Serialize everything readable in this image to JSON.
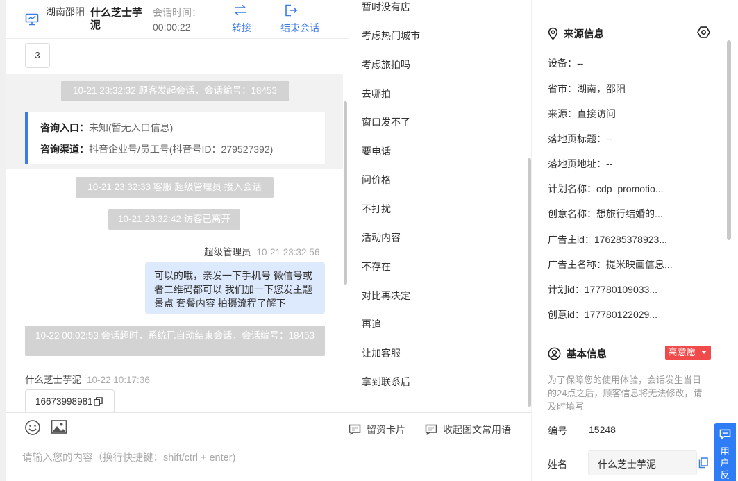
{
  "header": {
    "location": "湖南邵阳",
    "visitor_name": "什么芝士芋泥",
    "session_time_label": "会话时间：",
    "session_time_value": "00:00:22",
    "transfer_label": "转接",
    "end_label": "结束会话"
  },
  "messages": {
    "chip_count": "3",
    "system_1": "10-21 23:32:32 顾客发起会话，会话编号：18453",
    "entry_label": "咨询入口：",
    "entry_value": "未知(暂无入口信息)",
    "channel_label": "咨询渠道：",
    "channel_value": "抖音企业号/员工号(抖音号ID：279527392)",
    "system_2": "10-21 23:32:33 客服 超级管理员 接入会话",
    "system_3": "10-21 23:32:42 访客已离开",
    "agent_name": "超级管理员",
    "agent_time": "10-21 23:32:56",
    "agent_text": "可以的哦，亲发一下手机号 微信号或者二维码都可以 我们加一下您发主题景点 套餐内容 拍摄流程了解下",
    "system_4": "10-22 00:02:53 会话超时，系统已自动结束会话，会话编号：18453",
    "visitor_name": "什么芝士芋泥",
    "visitor_time": "10-22 10:17:36",
    "visitor_phone": "16673998981"
  },
  "quick_replies": [
    "暂时没有店",
    "考虑热门城市",
    "考虑旅拍吗",
    "去哪拍",
    "窗口发不了",
    "要电话",
    "问价格",
    "不打扰",
    "活动内容",
    "不存在",
    "对比再决定",
    "再追",
    "让加客服",
    "拿到联系后"
  ],
  "composer": {
    "card_label": "留资卡片",
    "collapse_label": "收起图文常用语",
    "placeholder": "请输入您的内容（换行快捷键：shift/ctrl + enter)"
  },
  "source_info": {
    "title": "来源信息",
    "rows": [
      "设备：--",
      "省市：湖南，邵阳",
      "来源：直接访问",
      "落地页标题：--",
      "落地页地址：--",
      "计划名称：cdp_promotio...",
      "创意名称：想旅行结婚的...",
      "广告主id：176285378923...",
      "广告主名称：提米映画信息...",
      "计划id：177780109033...",
      "创意id：177780122029..."
    ]
  },
  "basic_info": {
    "title": "基本信息",
    "intent_badge": "高意愿",
    "note": "为了保障您的使用体验，会话发生当日的24点之后，顾客信息将无法修改，请及时填写",
    "id_label": "编号",
    "id_value": "15248",
    "name_label": "姓名",
    "name_value": "什么芝士芋泥"
  },
  "feedback_tab": "用户反"
}
